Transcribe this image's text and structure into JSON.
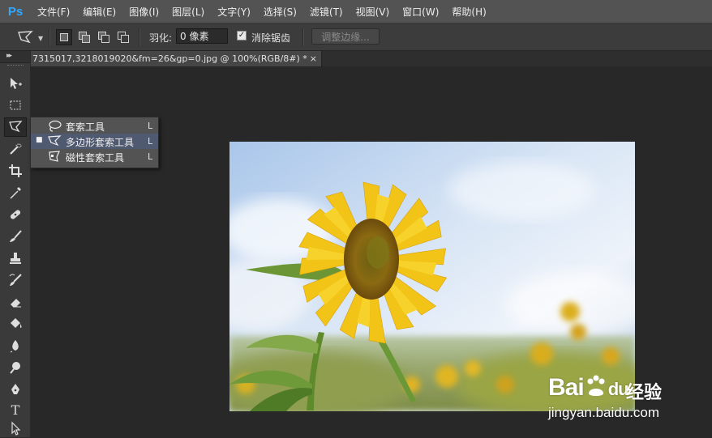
{
  "app": {
    "logo": "Ps"
  },
  "menu": [
    "文件(F)",
    "编辑(E)",
    "图像(I)",
    "图层(L)",
    "文字(Y)",
    "选择(S)",
    "滤镜(T)",
    "视图(V)",
    "窗口(W)",
    "帮助(H)"
  ],
  "options": {
    "feather_label": "羽化:",
    "feather_value": "0 像素",
    "antialias_label": "消除锯齿",
    "antialias_checked": true,
    "refine_edge_label": "调整边缘..."
  },
  "document_tab": {
    "title": "7315017,3218019020&fm=26&gp=0.jpg @ 100%(RGB/8#) *",
    "close": "×"
  },
  "panel_close": "×",
  "flyout": {
    "items": [
      {
        "label": "套索工具",
        "shortcut": "L",
        "selected": false,
        "icon": "lasso-icon"
      },
      {
        "label": "多边形套索工具",
        "shortcut": "L",
        "selected": true,
        "icon": "polygonal-lasso-icon"
      },
      {
        "label": "磁性套索工具",
        "shortcut": "L",
        "selected": false,
        "icon": "magnetic-lasso-icon"
      }
    ]
  },
  "tools": [
    "move-tool-icon",
    "marquee-tool-icon",
    "polygonal-lasso-tool-icon",
    "quick-selection-tool-icon",
    "crop-tool-icon",
    "eyedropper-tool-icon",
    "healing-brush-tool-icon",
    "brush-tool-icon",
    "clone-stamp-tool-icon",
    "history-brush-tool-icon",
    "eraser-tool-icon",
    "paint-bucket-tool-icon",
    "blur-tool-icon",
    "dodge-tool-icon",
    "pen-tool-icon",
    "type-tool-icon",
    "path-selection-tool-icon"
  ],
  "type_tool_glyph": "T",
  "watermark": {
    "brand": "Bai",
    "brand2": "du",
    "cn": "经验",
    "url": "jingyan.baidu.com"
  },
  "colors": {
    "ps_blue": "#31a8ff",
    "menubar": "#535353",
    "canvas": "#282828",
    "flyout_selected": "#4f5970"
  }
}
